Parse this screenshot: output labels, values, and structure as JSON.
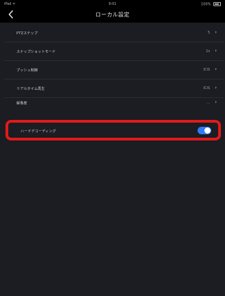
{
  "status_bar": {
    "carrier": "iPad ᯤ",
    "time": "9:01",
    "battery": "100%"
  },
  "nav": {
    "title": "ローカル設定",
    "back_icon": "chevron-left-icon"
  },
  "settings": {
    "rows": [
      {
        "label": "PTZステップ",
        "value": "5"
      },
      {
        "label": "スナップショットモード",
        "value": "1s"
      },
      {
        "label": "プッシュ制御",
        "value": "ICIS"
      },
      {
        "label": "リアルタイム再生",
        "value": "ICIS"
      },
      {
        "label": "解像度",
        "value": "…"
      }
    ],
    "highlighted_row": {
      "label": "ハードデコーディング",
      "toggle_on": true
    }
  },
  "colors": {
    "background": "#000000",
    "content": "#1b1d22",
    "highlight_border": "#e11a1a",
    "toggle_on": "#2f7bf5"
  }
}
